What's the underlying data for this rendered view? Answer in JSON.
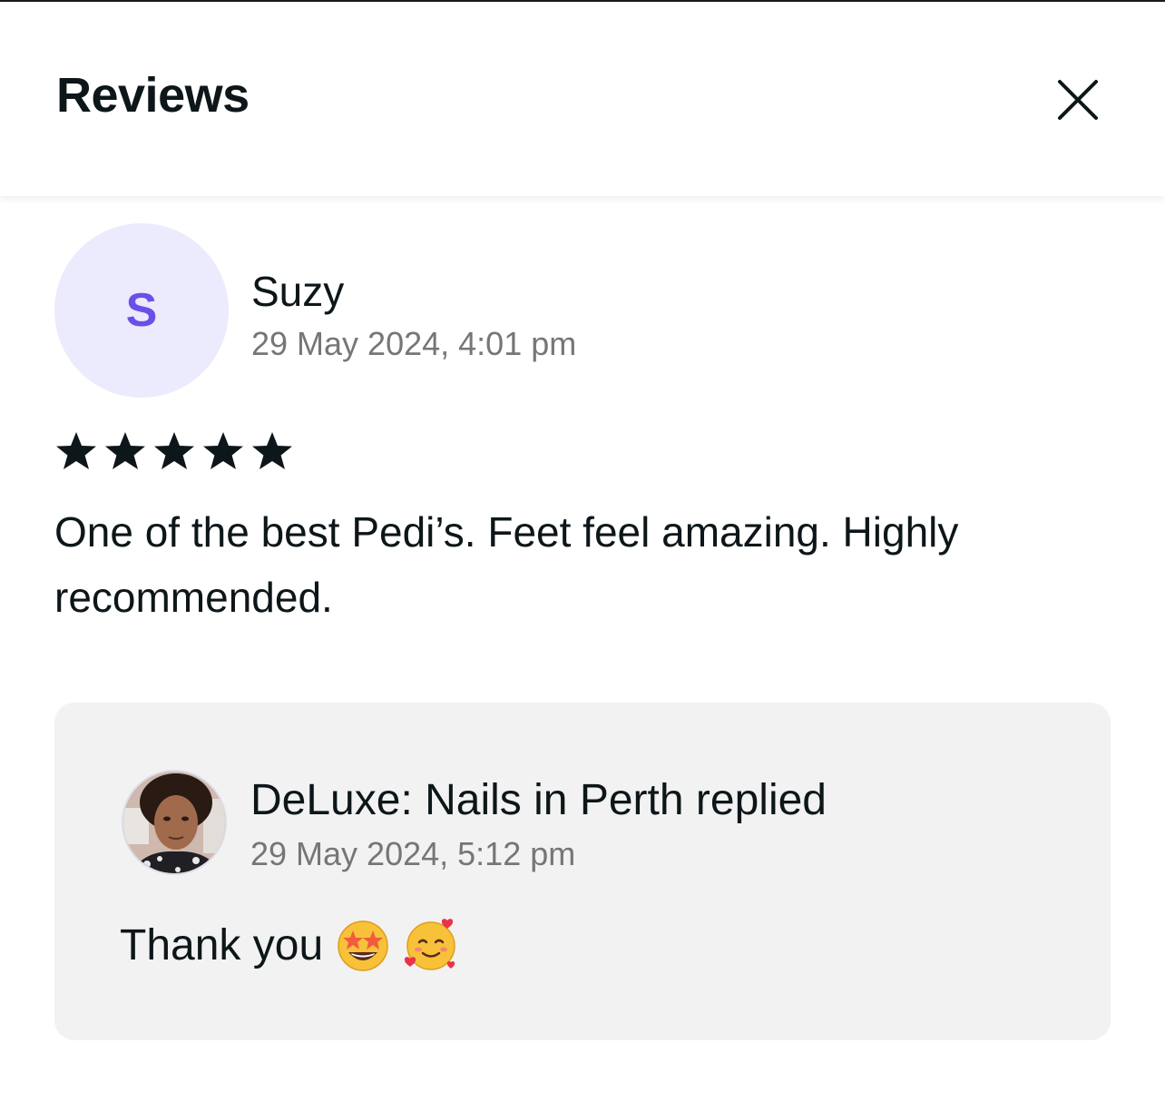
{
  "header": {
    "title": "Reviews",
    "close_icon": "close-icon"
  },
  "review": {
    "avatar_initial": "S",
    "reviewer_name": "Suzy",
    "date": "29 May 2024, 4:01 pm",
    "rating": 5,
    "rating_max": 5,
    "text": "One of the best Pedi’s. Feet feel amazing. Highly recommended."
  },
  "reply": {
    "title": "DeLuxe: Nails in Perth replied",
    "date": "29 May 2024, 5:12 pm",
    "text": "Thank you",
    "emojis": [
      "star-struck-emoji",
      "smiling-face-with-hearts-emoji"
    ]
  },
  "colors": {
    "accent": "#6b50e8",
    "avatar_bg": "#ebebfd",
    "text_primary": "#0d1619",
    "text_secondary": "#767676",
    "card_bg": "#f2f2f2"
  }
}
